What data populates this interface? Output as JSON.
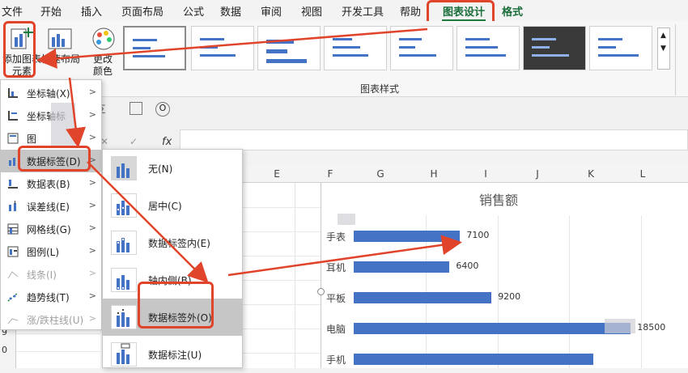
{
  "ribbon_tabs": [
    "文件",
    "开始",
    "插入",
    "页面布局",
    "公式",
    "数据",
    "审阅",
    "视图",
    "开发工具",
    "帮助",
    "图表设计",
    "格式"
  ],
  "active_tab": "图表设计",
  "ribbon": {
    "add_element_label_1": "添加图表",
    "add_element_label_2": "元素",
    "quick_layout_label": "快速布局",
    "change_colors_label_1": "更改",
    "change_colors_label_2": "颜色",
    "chart_styles_group": "图表样式"
  },
  "formula": {
    "fx": "fx"
  },
  "columns": [
    "E",
    "F",
    "G",
    "H",
    "I",
    "J",
    "K",
    "L"
  ],
  "row_numbers": [
    "9",
    "0"
  ],
  "menu1": {
    "items": [
      {
        "label": "坐标轴(X)",
        "has_submenu": true,
        "enabled": true
      },
      {
        "label": "坐标轴标",
        "has_submenu": true,
        "enabled": true
      },
      {
        "label": "图",
        "has_submenu": true,
        "enabled": true
      },
      {
        "label": "数据标签(D)",
        "has_submenu": true,
        "enabled": true,
        "highlighted": true
      },
      {
        "label": "数据表(B)",
        "has_submenu": true,
        "enabled": true
      },
      {
        "label": "误差线(E)",
        "has_submenu": true,
        "enabled": true
      },
      {
        "label": "网格线(G)",
        "has_submenu": true,
        "enabled": true
      },
      {
        "label": "图例(L)",
        "has_submenu": true,
        "enabled": true
      },
      {
        "label": "线条(I)",
        "has_submenu": true,
        "enabled": false
      },
      {
        "label": "趋势线(T)",
        "has_submenu": true,
        "enabled": true
      },
      {
        "label": "涨/跌柱线(U)",
        "has_submenu": true,
        "enabled": false
      }
    ]
  },
  "menu2": {
    "items": [
      {
        "label": "无(N)"
      },
      {
        "label": "居中(C)"
      },
      {
        "label": "数据标签内(E)"
      },
      {
        "label": "轴内侧(B)"
      },
      {
        "label": "数据标签外(O)",
        "highlighted": true
      },
      {
        "label": "数据标注(U)"
      }
    ]
  },
  "chart_data": {
    "type": "bar",
    "orientation": "horizontal",
    "title": "销售额",
    "categories": [
      "手表",
      "耳机",
      "平板",
      "电脑",
      "手机"
    ],
    "values": [
      7100,
      6400,
      9200,
      18500,
      16000
    ],
    "data_labels": [
      "7100",
      "6400",
      "9200",
      "18500",
      ""
    ],
    "color": "#4472c4",
    "grid": true
  },
  "colors": {
    "accent_green": "#1f7a3f",
    "highlight_red": "#e0442b",
    "bar_blue": "#4472c4"
  }
}
